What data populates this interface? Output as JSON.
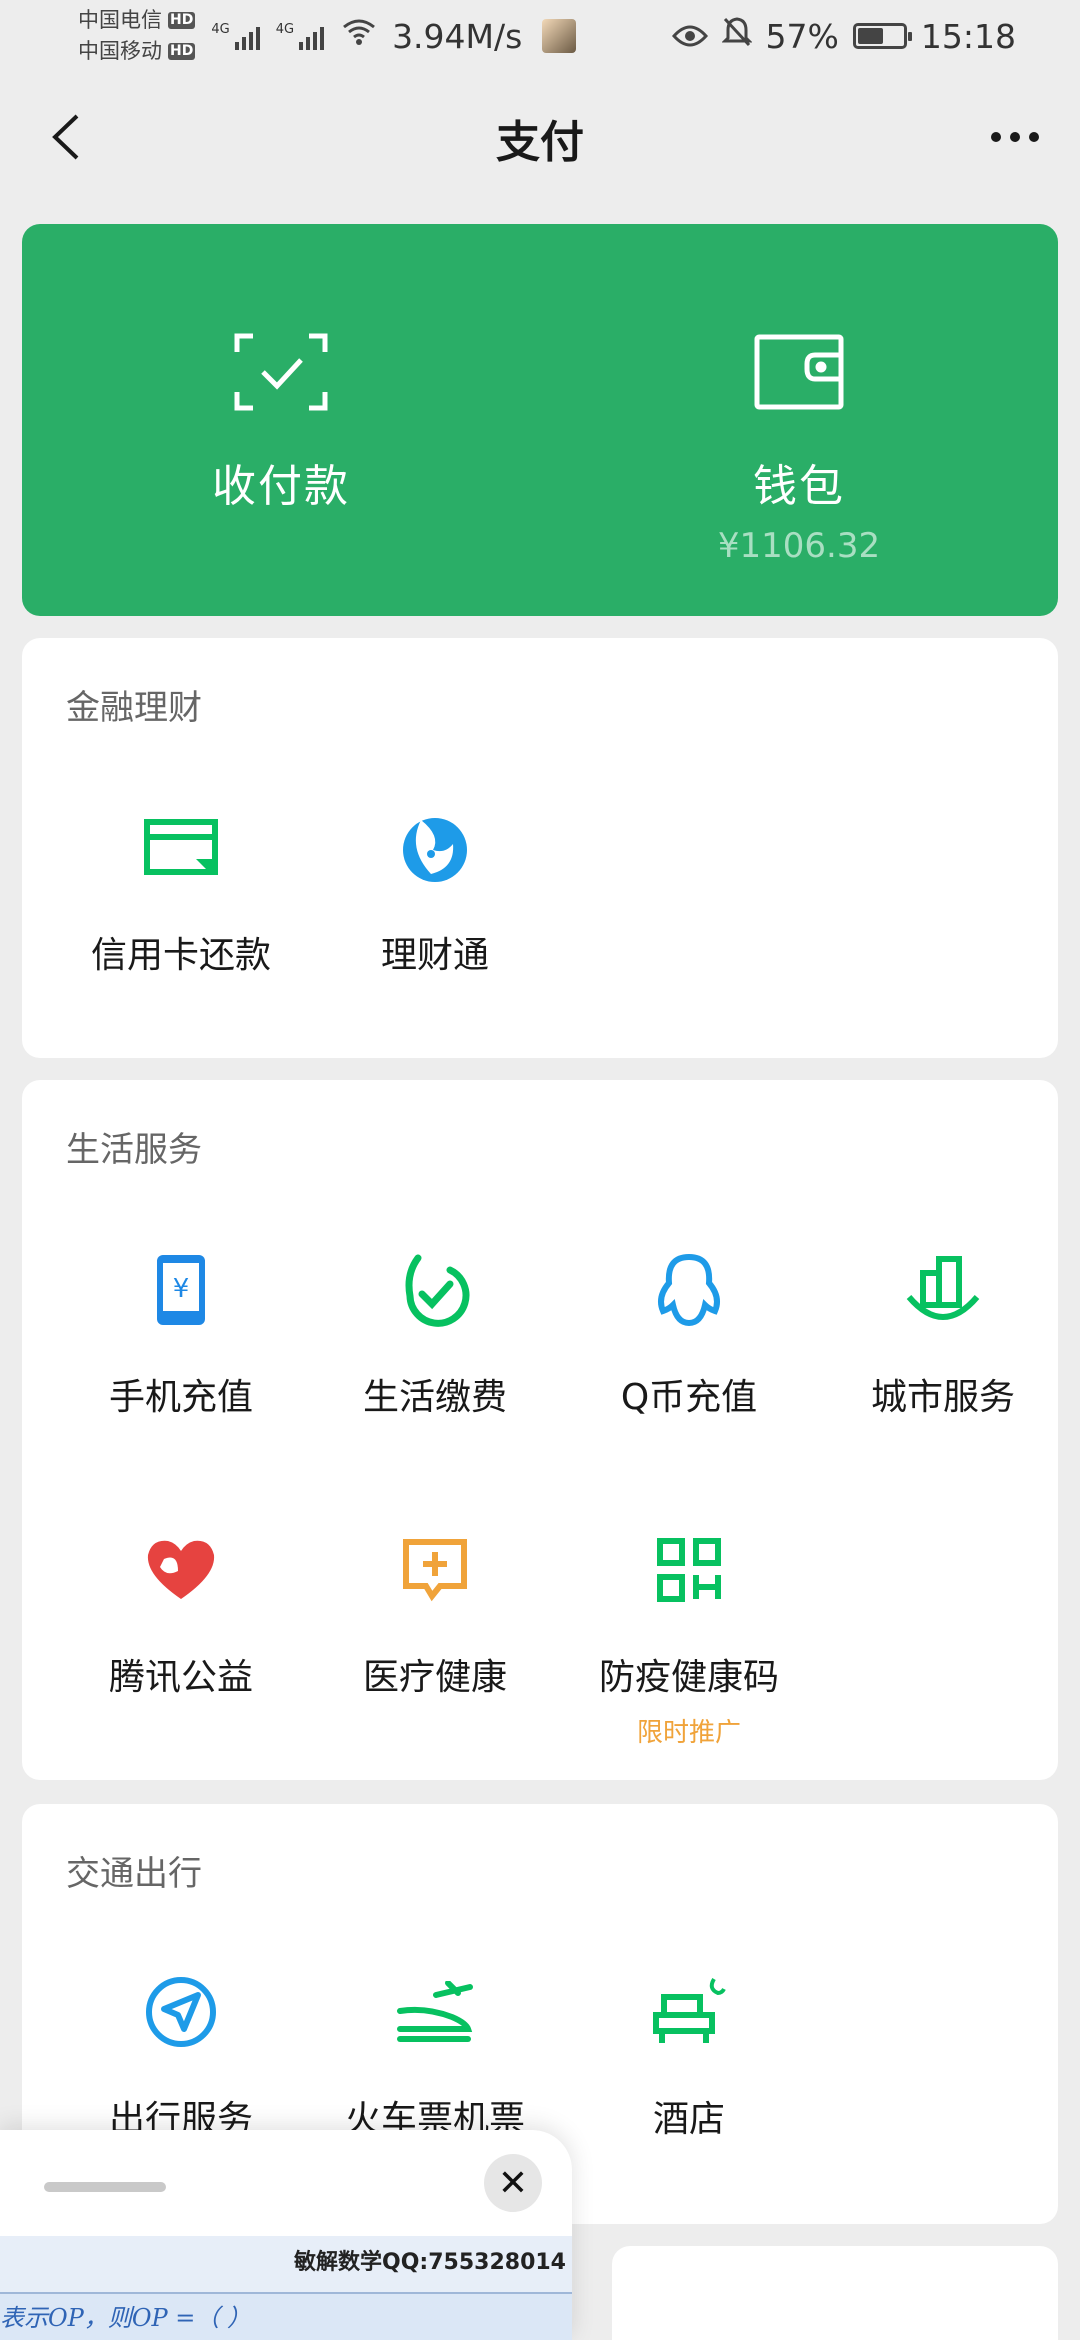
{
  "status_bar": {
    "carrier1": "中国电信",
    "carrier2": "中国移动",
    "hd": "HD",
    "net1": "4G",
    "net2": "4G",
    "speed": "3.94M/s",
    "battery_pct": "57%",
    "battery_level": 0.57,
    "time": "15:18"
  },
  "nav": {
    "title": "支付"
  },
  "hero": {
    "pay": {
      "label": "收付款",
      "icon": "scan-pay-icon"
    },
    "wallet": {
      "label": "钱包",
      "balance": "¥1106.32",
      "icon": "wallet-icon"
    }
  },
  "finance": {
    "title": "金融理财",
    "items": [
      {
        "label": "信用卡还款",
        "icon": "credit-card-icon",
        "color": "#07c160"
      },
      {
        "label": "理财通",
        "icon": "licaitong-icon",
        "color": "#1e9be8"
      }
    ]
  },
  "life": {
    "title": "生活服务",
    "items": [
      {
        "label": "手机充值",
        "icon": "phone-topup-icon",
        "color": "#1e88e5"
      },
      {
        "label": "生活缴费",
        "icon": "utility-bill-icon",
        "color": "#07c160"
      },
      {
        "label": "Q币充值",
        "icon": "qq-penguin-icon",
        "color": "#1e9be8"
      },
      {
        "label": "城市服务",
        "icon": "city-service-icon",
        "color": "#07c160"
      },
      {
        "label": "腾讯公益",
        "icon": "charity-heart-icon",
        "color": "#e64340"
      },
      {
        "label": "医疗健康",
        "icon": "medical-icon",
        "color": "#f0a33a"
      },
      {
        "label": "防疫健康码",
        "icon": "qr-health-code-icon",
        "color": "#07c160",
        "tag": "限时推广"
      }
    ]
  },
  "transport": {
    "title": "交通出行",
    "items": [
      {
        "label": "出行服务",
        "icon": "travel-navigation-icon",
        "color": "#1e9be8"
      },
      {
        "label": "火车票机票",
        "icon": "train-plane-icon",
        "color": "#07c160"
      },
      {
        "label": "酒店",
        "icon": "hotel-bed-icon",
        "color": "#07c160"
      }
    ]
  },
  "float_panel": {
    "close": "✕",
    "qq_text": "敏解数学QQ:755328014",
    "formula_text": "表示OP，则OP =（  ）"
  }
}
